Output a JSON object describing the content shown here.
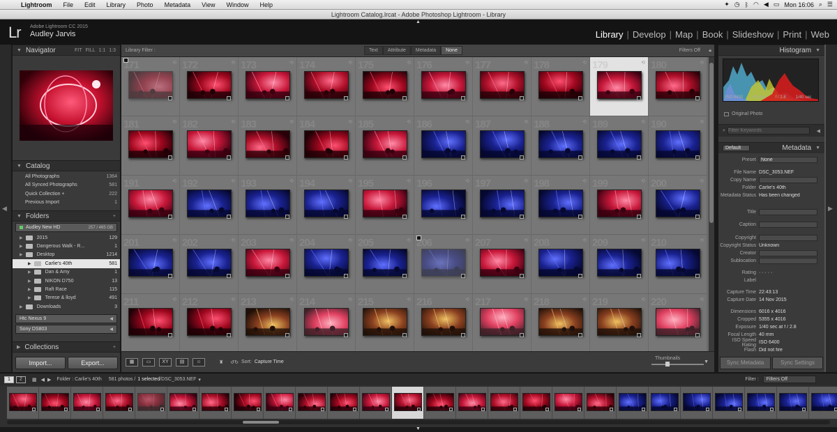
{
  "menubar": {
    "app": "Lightroom",
    "items": [
      "File",
      "Edit",
      "Library",
      "Photo",
      "Metadata",
      "View",
      "Window",
      "Help"
    ],
    "clock": "Mon 16:06"
  },
  "window_title": "Lightroom Catalog.lrcat - Adobe Photoshop Lightroom - Library",
  "identity": {
    "logo": "Lr",
    "product": "Adobe Lightroom CC 2015",
    "user": "Audley Jarvis"
  },
  "modules": [
    "Library",
    "Develop",
    "Map",
    "Book",
    "Slideshow",
    "Print",
    "Web"
  ],
  "active_module": "Library",
  "navigator": {
    "title": "Navigator",
    "zoom": [
      "FIT",
      "FILL",
      "1:1",
      "1:3"
    ]
  },
  "catalog": {
    "title": "Catalog",
    "items": [
      {
        "label": "All Photographs",
        "count": "1364"
      },
      {
        "label": "All Synced Photographs",
        "count": "581"
      },
      {
        "label": "Quick Collection +",
        "count": "222"
      },
      {
        "label": "Previous Import",
        "count": "1"
      }
    ]
  },
  "folders": {
    "title": "Folders",
    "drive": {
      "name": "Audley New HD",
      "size": "257 / 465 GB"
    },
    "items": [
      {
        "label": "2015",
        "count": "129",
        "indent": 1,
        "selected": false
      },
      {
        "label": "Dangerous Walk - R...",
        "count": "1",
        "indent": 1,
        "selected": false
      },
      {
        "label": "Desktop",
        "count": "1214",
        "indent": 1,
        "selected": false
      },
      {
        "label": "Carlie's 40th",
        "count": "581",
        "indent": 2,
        "selected": true
      },
      {
        "label": "Dan & Amy",
        "count": "1",
        "indent": 2,
        "selected": false
      },
      {
        "label": "NIKON D750",
        "count": "13",
        "indent": 2,
        "selected": false
      },
      {
        "label": "Raft Race",
        "count": "115",
        "indent": 2,
        "selected": false
      },
      {
        "label": "Terese & lloyd",
        "count": "491",
        "indent": 2,
        "selected": false
      },
      {
        "label": "Downloads",
        "count": "3",
        "indent": 1,
        "selected": false
      }
    ],
    "devices": [
      "Htc Nexus 9",
      "Sony DS803"
    ]
  },
  "collections": {
    "title": "Collections"
  },
  "buttons": {
    "import": "Import...",
    "export": "Export..."
  },
  "library_filter": {
    "label": "Library Filter :",
    "options": [
      "Text",
      "Attribute",
      "Metadata",
      "None"
    ],
    "active": "None",
    "filters_off": "Filters Off"
  },
  "grid": {
    "numbers": [
      "171",
      "172",
      "173",
      "174",
      "175",
      "176",
      "177",
      "178",
      "179",
      "180",
      "181",
      "182",
      "183",
      "184",
      "185",
      "186",
      "187",
      "188",
      "189",
      "190",
      "191",
      "192",
      "193",
      "194",
      "195",
      "196",
      "197",
      "198",
      "199",
      "200",
      "201",
      "202",
      "203",
      "204",
      "205",
      "206",
      "207",
      "208",
      "209",
      "210",
      "211",
      "212",
      "213",
      "214",
      "215",
      "216",
      "217",
      "218",
      "219",
      "220"
    ],
    "selected": "179"
  },
  "toolbar": {
    "sort_label": "Sort:",
    "sort_value": "Capture Time",
    "thumbnails_label": "Thumbnails"
  },
  "histogram": {
    "title": "Histogram",
    "iso": "ISO 6400",
    "focal": "40 mm",
    "aperture": "f / 2.8",
    "shutter": "1/40 sec",
    "original": "Original Photo"
  },
  "keyword": {
    "placeholder": "Filter Keywords"
  },
  "metadata": {
    "title": "Metadata",
    "preset_dropdown": "Default",
    "preset_label": "Preset",
    "preset_value": "None",
    "fields": [
      {
        "k": "File Name",
        "v": "DSC_3053.NEF"
      },
      {
        "k": "Copy Name",
        "v": ""
      },
      {
        "k": "Folder",
        "v": "Carlie's 40th"
      },
      {
        "k": "Metadata Status",
        "v": "Has been changed"
      }
    ],
    "fields2": [
      {
        "k": "Title",
        "v": ""
      },
      {
        "k": "Caption",
        "v": ""
      },
      {
        "k": "Copyright",
        "v": ""
      },
      {
        "k": "Copyright Status",
        "v": "Unknown"
      },
      {
        "k": "Creator",
        "v": ""
      },
      {
        "k": "Sublocation",
        "v": ""
      },
      {
        "k": "Rating",
        "v": "· · · · ·"
      },
      {
        "k": "Label",
        "v": ""
      },
      {
        "k": "Capture Time",
        "v": "22:43:13"
      },
      {
        "k": "Capture Date",
        "v": "14 Nov 2015"
      },
      {
        "k": "Dimensions",
        "v": "6016 x 4016"
      },
      {
        "k": "Cropped",
        "v": "5355 x 4016"
      },
      {
        "k": "Exposure",
        "v": "1/40 sec at f / 2.8"
      },
      {
        "k": "Focal Length",
        "v": "40 mm"
      },
      {
        "k": "ISO Speed Rating",
        "v": "ISO 6400"
      },
      {
        "k": "Flash",
        "v": "Did not fire"
      }
    ]
  },
  "sync": {
    "metadata": "Sync Metadata",
    "settings": "Sync Settings"
  },
  "filmstrip": {
    "monitors": [
      "1",
      "2"
    ],
    "folder": "Folder : Carlie's 40th",
    "count": "581 photos /",
    "selected": "1 selected",
    "file": "/DSC_3053.NEF",
    "filter_label": "Filter :",
    "filter_value": "Filters Off"
  },
  "colors": {
    "accent": "#e8e8e8",
    "panel": "#3a3a3a",
    "grid_bg": "#6c6c6c"
  }
}
